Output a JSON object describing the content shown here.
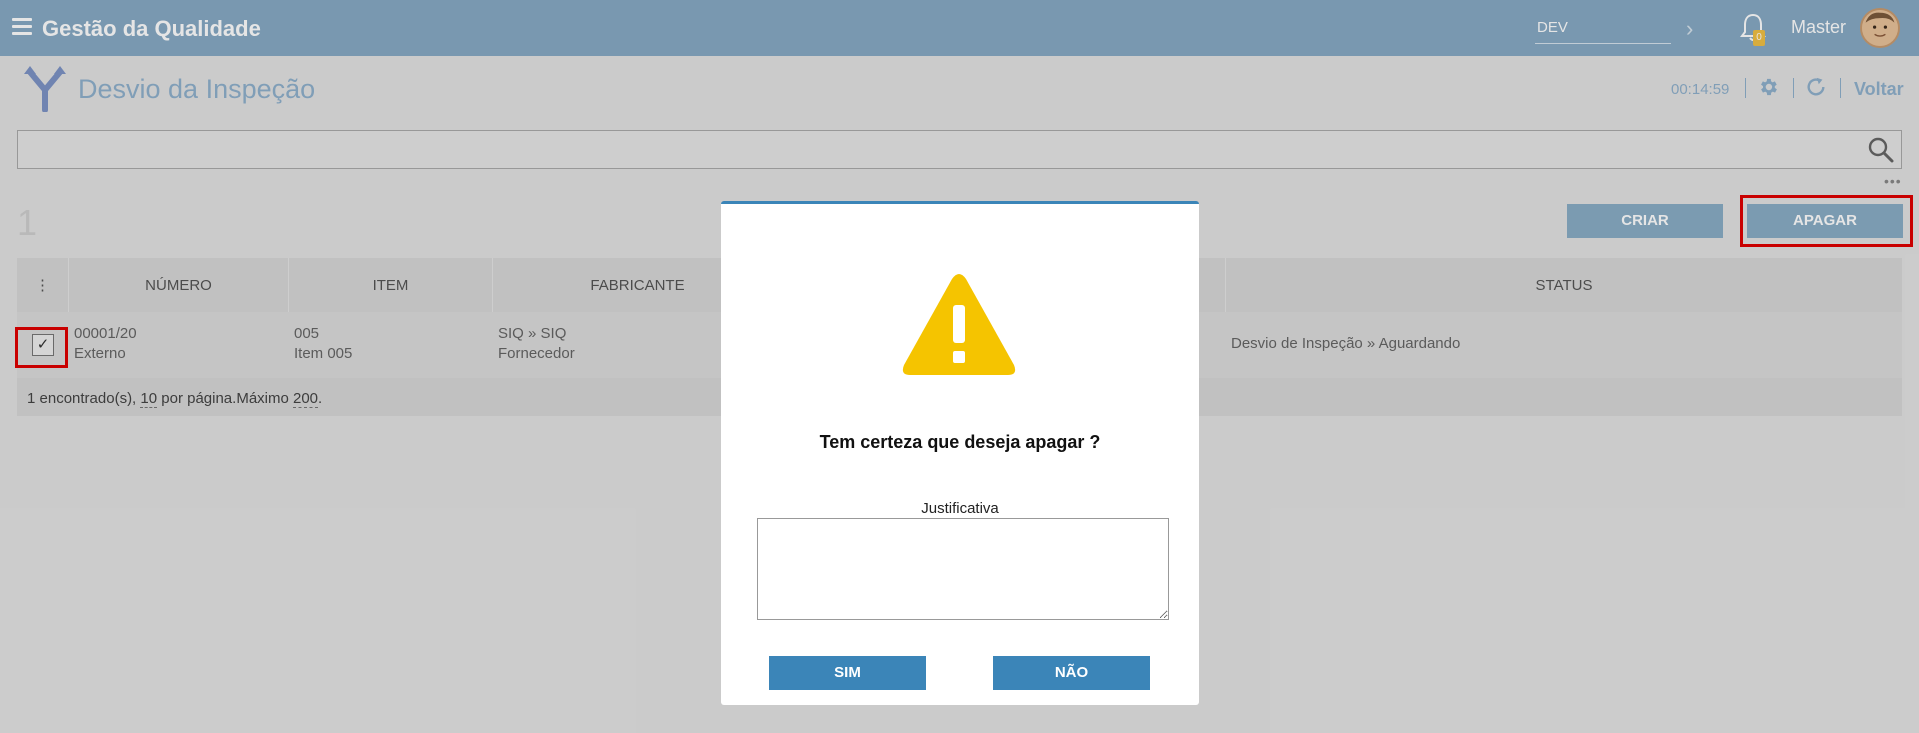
{
  "header": {
    "app_title": "Gestão da Qualidade",
    "environment": "DEV",
    "notification_count": "0",
    "user_name": "Master"
  },
  "page": {
    "title": "Desvio da Inspeção",
    "timer": "00:14:59",
    "back_label": "Voltar"
  },
  "search": {
    "value": "",
    "placeholder": ""
  },
  "toolbar": {
    "more": "•••",
    "record_count": "1",
    "create_label": "CRIAR",
    "delete_label": "APAGAR"
  },
  "table": {
    "menu_icon": "⋮",
    "headers": {
      "numero": "NÚMERO",
      "item": "ITEM",
      "fabricante": "FABRICANTE",
      "status": "STATUS"
    },
    "rows": [
      {
        "checked": "✓",
        "numero": "00001/20",
        "numero_sub": "Externo",
        "item": "005",
        "item_sub": "Item 005",
        "fabricante": "SIQ » SIQ",
        "fabricante_sub": "Fornecedor",
        "status": "Desvio de Inspeção » Aguardando"
      }
    ],
    "footer": {
      "found": "1 encontrado(s), ",
      "per_page_value": "10",
      "per_page_text": " por página.Máximo ",
      "max_value": "200",
      "end": "."
    }
  },
  "modal": {
    "question": "Tem certeza que deseja apagar ?",
    "justification_label": "Justificativa",
    "justification_value": "",
    "yes_label": "SIM",
    "no_label": "NÃO"
  },
  "colors": {
    "topbar": "#87aac5",
    "primary_button": "#3b85b8",
    "warning": "#f5c400",
    "highlight": "#e00000"
  }
}
